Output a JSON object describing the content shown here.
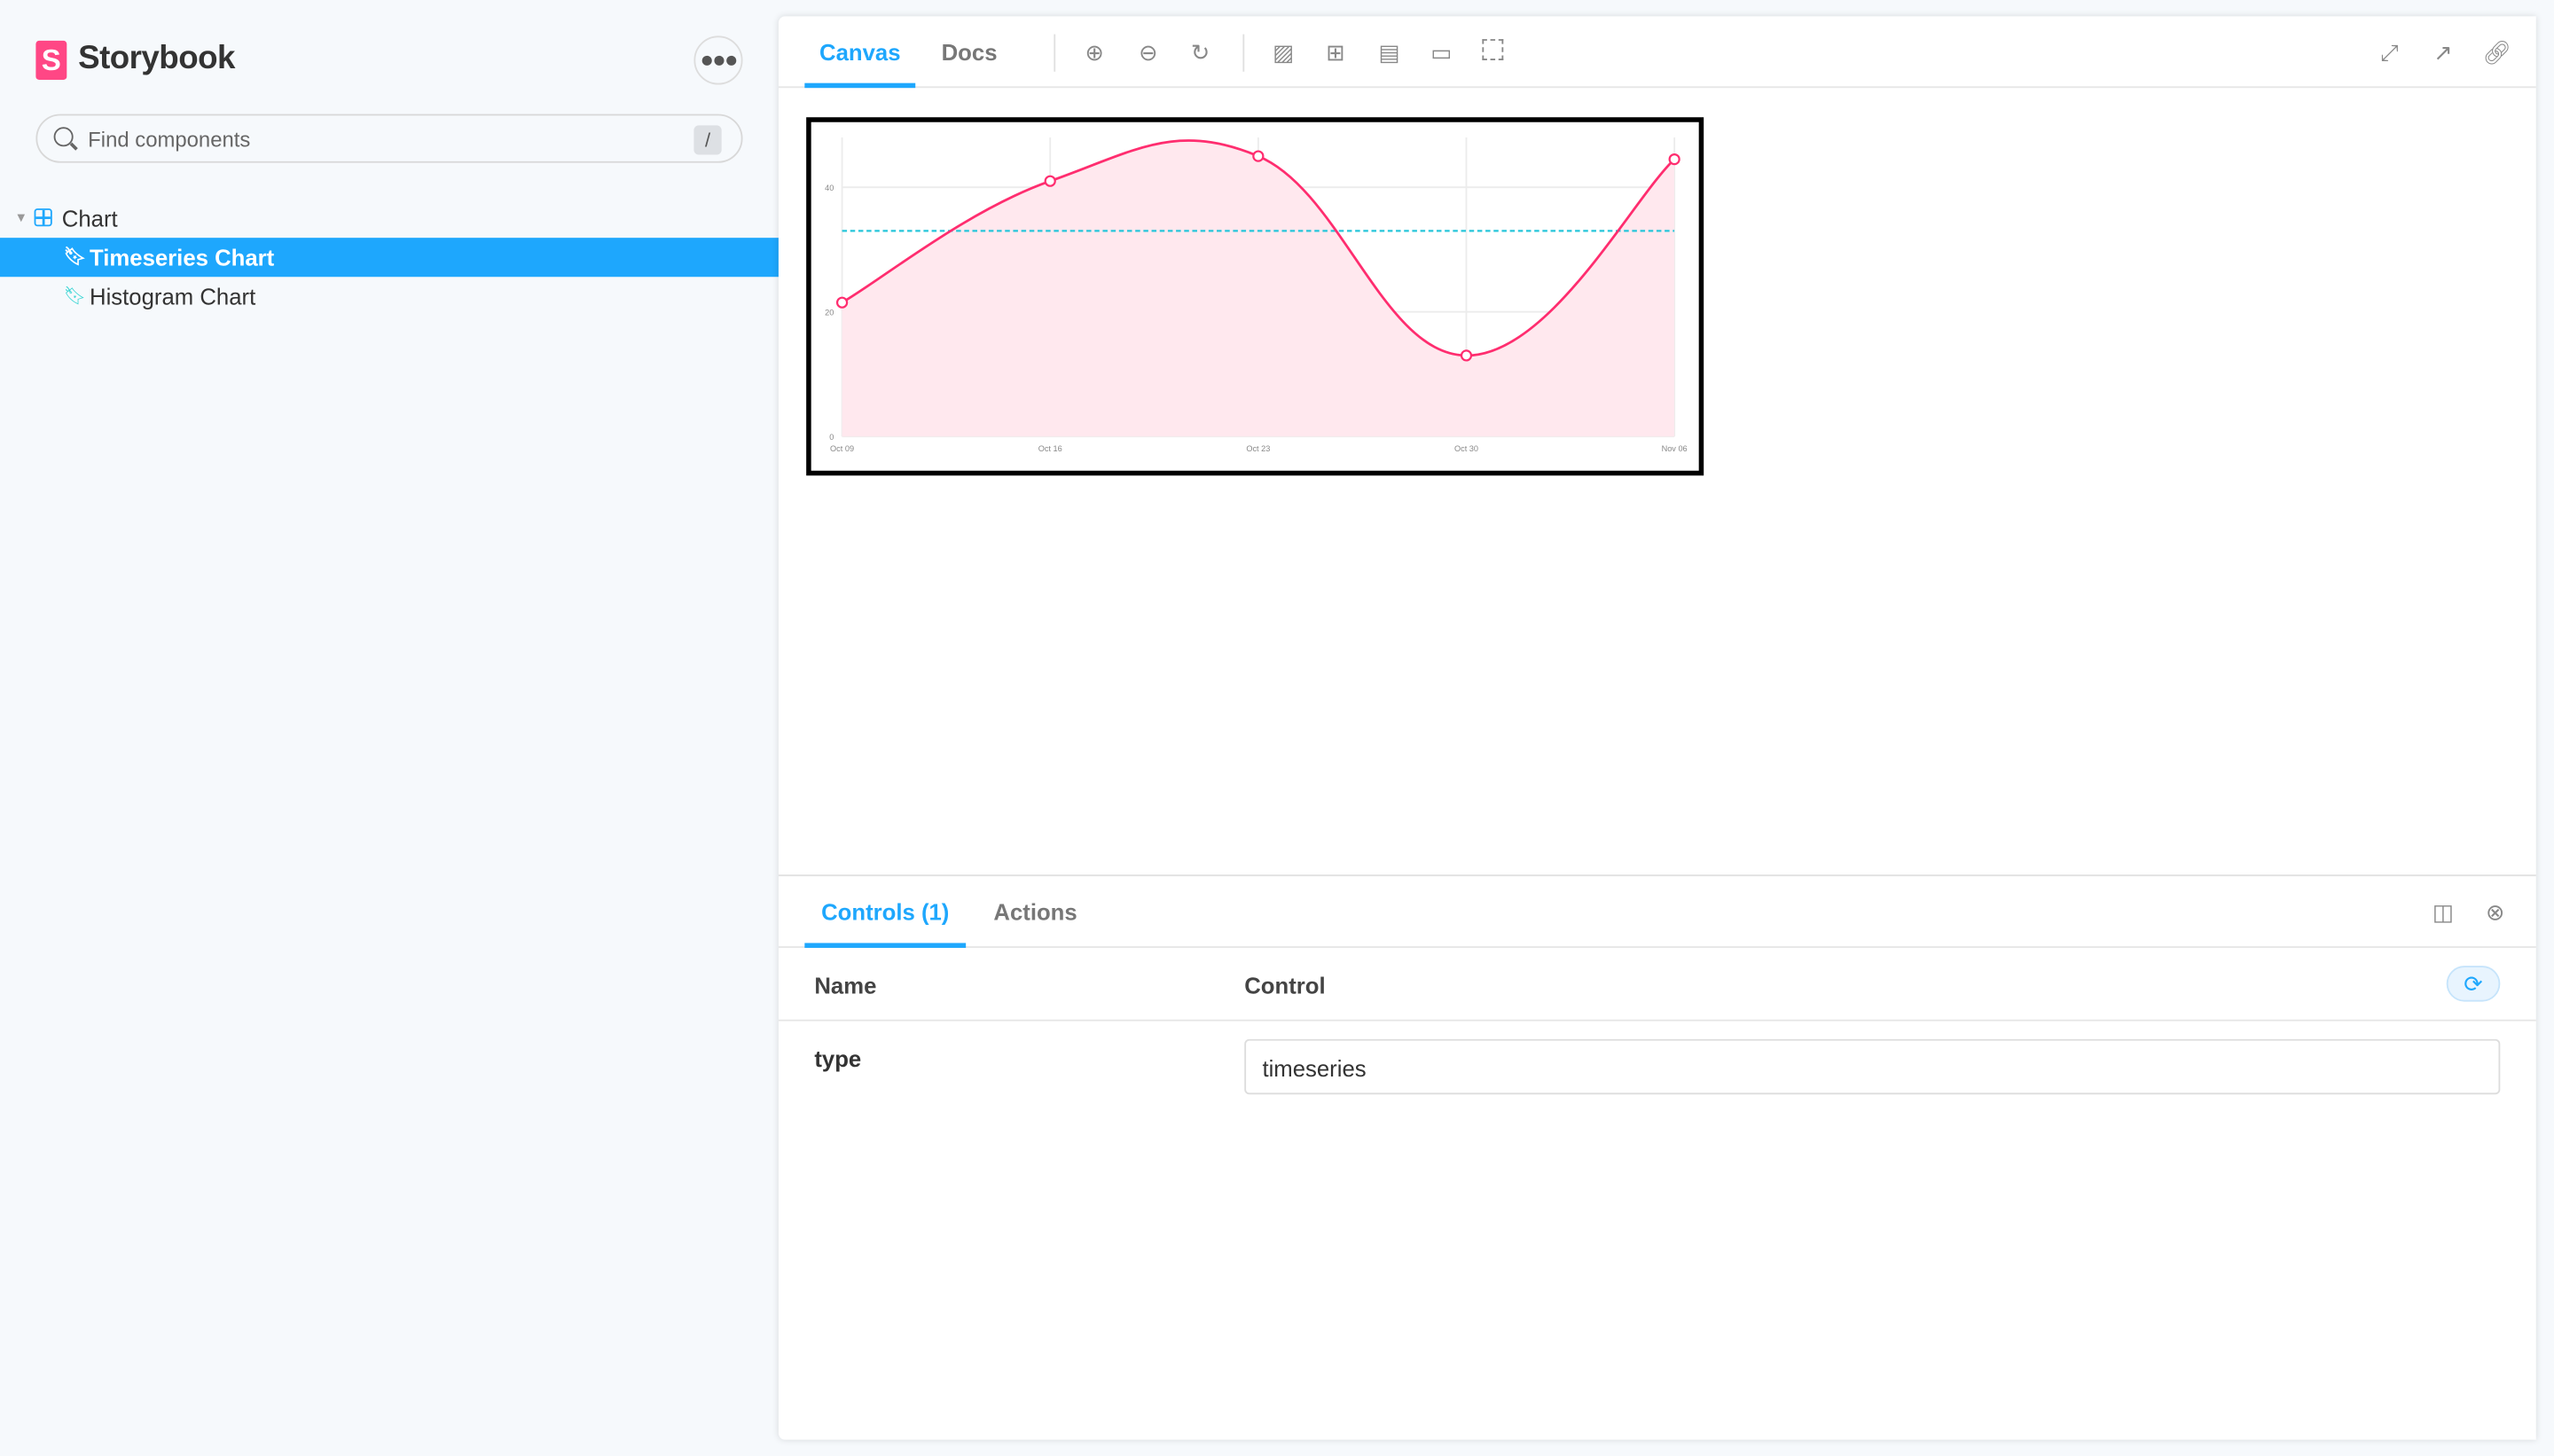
{
  "app": {
    "title": "Storybook",
    "brand_color": "#ff4785",
    "accent_color": "#1ea7fd",
    "search_placeholder": "Find components",
    "search_shortcut": "/"
  },
  "sidebar": {
    "group": "Chart",
    "items": [
      {
        "label": "Timeseries Chart",
        "selected": true
      },
      {
        "label": "Histogram Chart",
        "selected": false
      }
    ]
  },
  "toolbar": {
    "tabs": [
      "Canvas",
      "Docs"
    ],
    "active_tab": "Canvas",
    "icons": [
      "zoom-in-icon",
      "zoom-out-icon",
      "reset-zoom-icon",
      "background-icon",
      "grid-icon",
      "viewport-icon",
      "measure-icon",
      "outline-icon"
    ],
    "right_icons": [
      "fullscreen-icon",
      "open-new-tab-icon",
      "copy-link-icon"
    ]
  },
  "panel": {
    "tabs": [
      "Controls (1)",
      "Actions"
    ],
    "active_tab": "Controls (1)",
    "headers": {
      "name": "Name",
      "control": "Control"
    },
    "rows": [
      {
        "name": "type",
        "value": "timeseries"
      }
    ]
  },
  "chart_data": {
    "type": "area",
    "x": [
      "Oct 09",
      "Oct 16",
      "Oct 23",
      "Oct 30",
      "Nov 06"
    ],
    "series": [
      {
        "values": [
          21.5,
          41,
          45,
          13,
          44.5
        ],
        "color": "#ff2d6f",
        "fill": "#ffe8ee"
      }
    ],
    "reference_line": {
      "value": 33,
      "color": "#26c6da",
      "style": "dashed"
    },
    "yticks": [
      0,
      20,
      40
    ],
    "ylim": [
      0,
      48
    ],
    "grid": true
  }
}
